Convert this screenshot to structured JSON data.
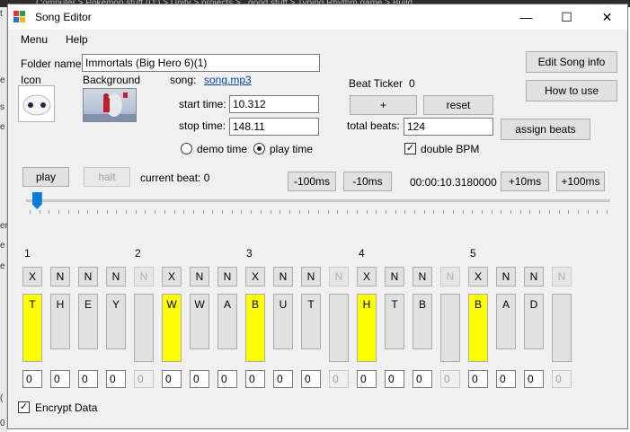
{
  "background_title": "Computer  >  Pokemon stuff (D:)  >  Unity  >  projects  >  _good stuff  >  Typing Rhythm game  >  Build",
  "left_strip_chars": [
    "t",
    "e",
    "s",
    "e",
    "er",
    "e",
    "e",
    "(",
    "0"
  ],
  "window": {
    "title": "Song Editor",
    "minimize": "—",
    "maximize": "☐",
    "close": "✕"
  },
  "menu": [
    "Menu",
    "Help"
  ],
  "form": {
    "folder_label": "Folder name",
    "folder_value": "Immortals (Big Hero 6)(1)",
    "icon_label": "Icon",
    "background_label": "Background",
    "song_label": "song:",
    "song_link": "song.mp3",
    "start_label": "start time:",
    "start_value": "10.312",
    "stop_label": "stop time:",
    "stop_value": "148.11",
    "demo_time": "demo time",
    "play_time": "play time",
    "selected_time_mode": "play time",
    "beat_ticker_label": "Beat Ticker",
    "beat_ticker_value": "0",
    "plus_label": "+",
    "reset_label": "reset",
    "total_beats_label": "total beats:",
    "total_beats_value": "124",
    "double_bpm_label": "double BPM",
    "double_bpm_checked": true,
    "edit_song_info": "Edit Song info",
    "how_to_use": "How to use",
    "assign_beats": "assign beats"
  },
  "transport": {
    "play": "play",
    "halt": "halt",
    "current_beat_label": "current beat: 0",
    "minus100": "-100ms",
    "minus10": "-10ms",
    "time_readout": "00:00:10.3180000",
    "plus10": "+10ms",
    "plus100": "+100ms",
    "slider_position": 0.02
  },
  "beat_numbers": [
    "1",
    "2",
    "3",
    "4",
    "5"
  ],
  "slots": [
    {
      "btn": "X",
      "lane": "T",
      "hit": true,
      "num": "0",
      "enabled": true
    },
    {
      "btn": "N",
      "lane": "H",
      "hit": false,
      "num": "0",
      "enabled": true
    },
    {
      "btn": "N",
      "lane": "E",
      "hit": false,
      "num": "0",
      "enabled": true
    },
    {
      "btn": "N",
      "lane": "Y",
      "hit": false,
      "num": "0",
      "enabled": true
    },
    {
      "btn": "N",
      "lane": "",
      "hit": false,
      "num": "0",
      "enabled": false
    },
    {
      "btn": "X",
      "lane": "W",
      "hit": true,
      "num": "0",
      "enabled": true
    },
    {
      "btn": "N",
      "lane": "W",
      "hit": false,
      "num": "0",
      "enabled": true
    },
    {
      "btn": "N",
      "lane": "A",
      "hit": false,
      "num": "0",
      "enabled": true
    },
    {
      "btn": "X",
      "lane": "B",
      "hit": true,
      "num": "0",
      "enabled": true
    },
    {
      "btn": "N",
      "lane": "U",
      "hit": false,
      "num": "0",
      "enabled": true
    },
    {
      "btn": "N",
      "lane": "T",
      "hit": false,
      "num": "0",
      "enabled": true
    },
    {
      "btn": "N",
      "lane": "",
      "hit": false,
      "num": "0",
      "enabled": false
    },
    {
      "btn": "X",
      "lane": "H",
      "hit": true,
      "num": "0",
      "enabled": true
    },
    {
      "btn": "N",
      "lane": "T",
      "hit": false,
      "num": "0",
      "enabled": true
    },
    {
      "btn": "N",
      "lane": "B",
      "hit": false,
      "num": "0",
      "enabled": true
    },
    {
      "btn": "N",
      "lane": "",
      "hit": false,
      "num": "0",
      "enabled": false
    },
    {
      "btn": "X",
      "lane": "B",
      "hit": true,
      "num": "0",
      "enabled": true
    },
    {
      "btn": "N",
      "lane": "A",
      "hit": false,
      "num": "0",
      "enabled": true
    },
    {
      "btn": "N",
      "lane": "D",
      "hit": false,
      "num": "0",
      "enabled": true
    },
    {
      "btn": "N",
      "lane": "",
      "hit": false,
      "num": "0",
      "enabled": false
    }
  ],
  "encrypt_label": "Encrypt Data",
  "encrypt_checked": true,
  "colors": {
    "accent": "#0a7bd6",
    "hit": "#ffff00",
    "link": "#0645ad"
  }
}
